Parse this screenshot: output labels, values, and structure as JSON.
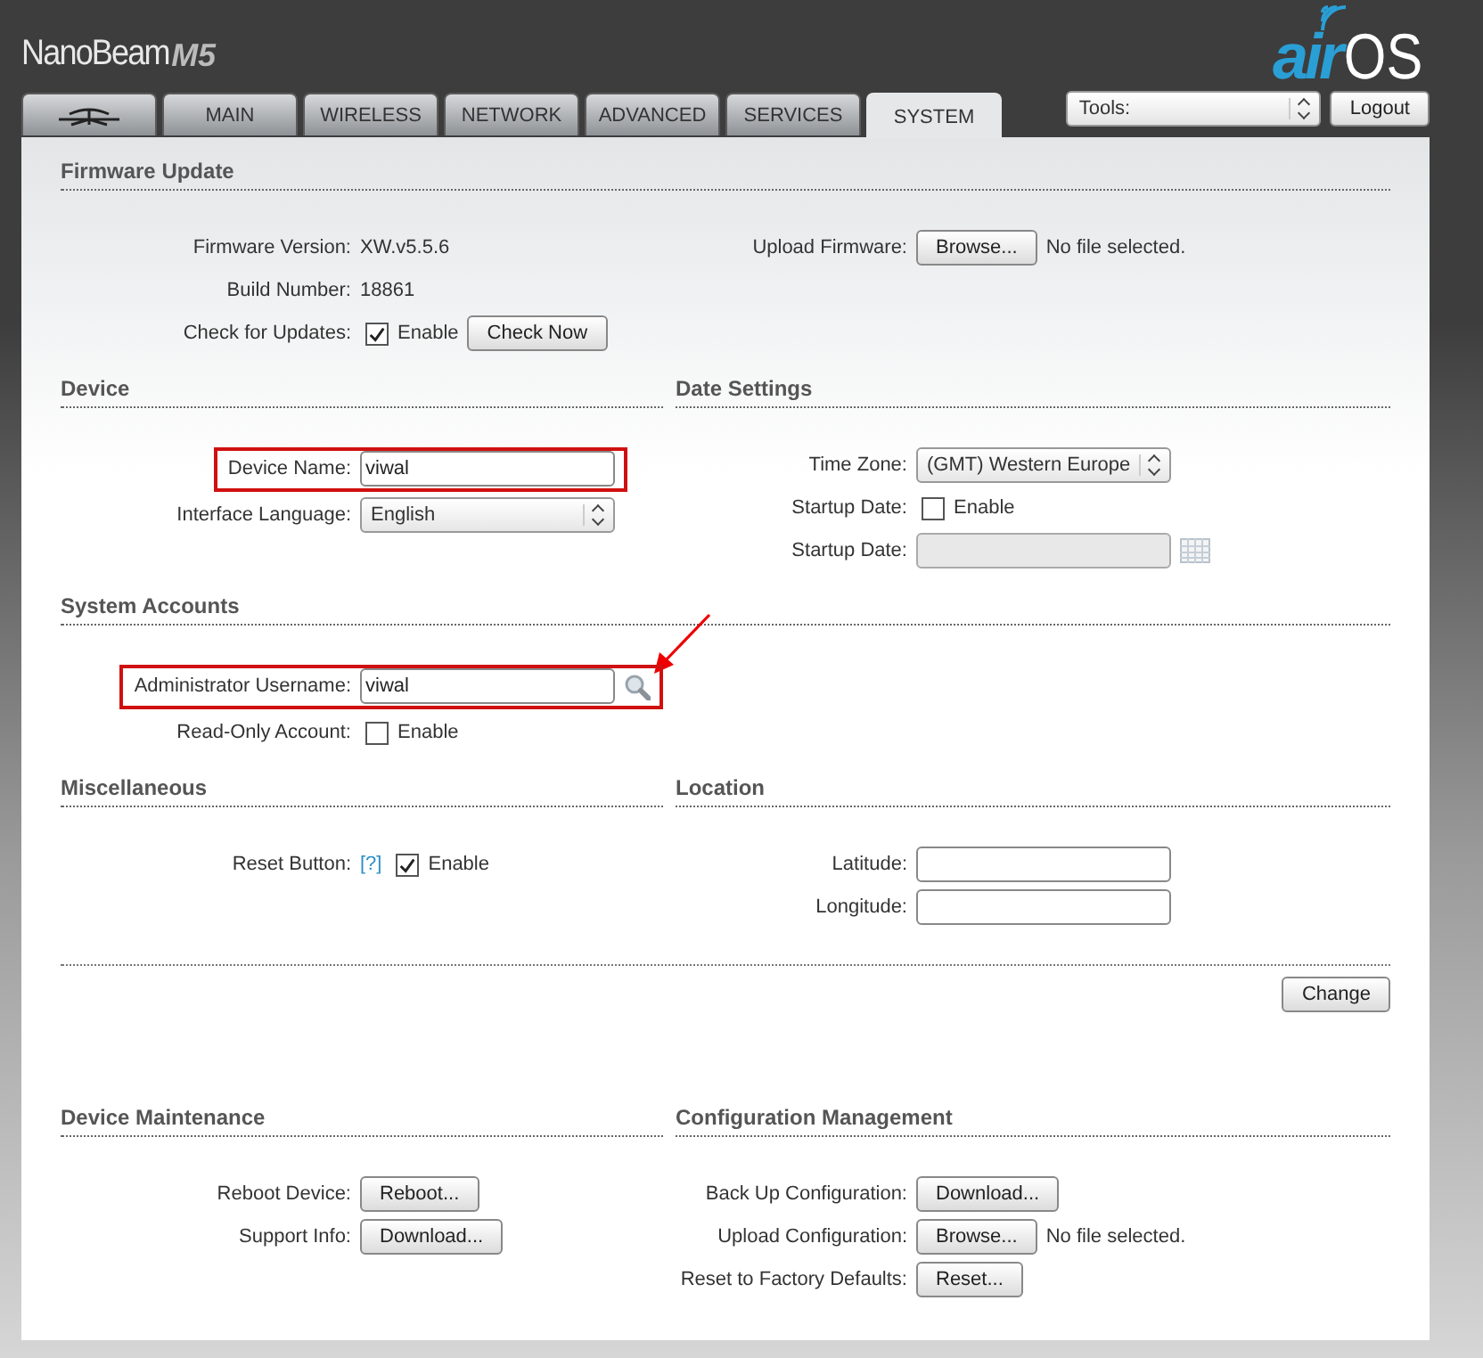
{
  "header": {
    "product": "NanoBeam",
    "model": "M5",
    "logo_prefix": "air",
    "logo_suffix": "OS"
  },
  "tabs": [
    {
      "kind": "icon",
      "selected": false
    },
    {
      "kind": "text",
      "label": "MAIN",
      "selected": false
    },
    {
      "kind": "text",
      "label": "WIRELESS",
      "selected": false
    },
    {
      "kind": "text",
      "label": "NETWORK",
      "selected": false
    },
    {
      "kind": "text",
      "label": "ADVANCED",
      "selected": false
    },
    {
      "kind": "text",
      "label": "SERVICES",
      "selected": false
    },
    {
      "kind": "text",
      "label": "SYSTEM",
      "selected": true
    }
  ],
  "tools": {
    "value": "Tools:"
  },
  "logout": "Logout",
  "blocks": [
    {
      "kind": "sections",
      "title": "Firmware Update",
      "columns": [
        {
          "fields": [
            {
              "label": "Firmware Version:",
              "highlighted": false,
              "controls": [
                {
                  "kind": "value",
                  "text": "XW.v5.5.6"
                }
              ]
            },
            {
              "label": "Build Number:",
              "highlighted": false,
              "controls": [
                {
                  "kind": "value",
                  "text": "18861"
                }
              ]
            },
            {
              "label": "Check for Updates:",
              "highlighted": false,
              "controls": [
                {
                  "kind": "checkbox",
                  "checked": true,
                  "text": "Enable"
                },
                {
                  "kind": "button",
                  "text": "Check Now"
                }
              ]
            }
          ]
        },
        {
          "fields": [
            {
              "label": "Upload Firmware:",
              "highlighted": false,
              "controls": [
                {
                  "kind": "button",
                  "text": "Browse..."
                },
                {
                  "kind": "note",
                  "text": "No file selected."
                }
              ]
            }
          ]
        }
      ]
    },
    {
      "kind": "sections",
      "columns": [
        {
          "title": "Device",
          "fields": [
            {
              "label": "Device Name:",
              "highlighted": true,
              "controls": [
                {
                  "kind": "input",
                  "value": "viwal"
                }
              ]
            },
            {
              "label": "Interface Language:",
              "highlighted": false,
              "controls": [
                {
                  "kind": "select",
                  "value": "English"
                }
              ]
            }
          ]
        },
        {
          "title": "Date Settings",
          "fields": [
            {
              "label": "Time Zone:",
              "highlighted": false,
              "controls": [
                {
                  "kind": "select",
                  "value": "(GMT) Western Europe"
                }
              ]
            },
            {
              "label": "Startup Date:",
              "highlighted": false,
              "controls": [
                {
                  "kind": "checkbox",
                  "checked": false,
                  "text": "Enable"
                }
              ]
            },
            {
              "label": "Startup Date:",
              "highlighted": false,
              "controls": [
                {
                  "kind": "date",
                  "disabled": true
                }
              ]
            }
          ]
        }
      ]
    },
    {
      "kind": "sections",
      "title": "System Accounts",
      "columns": [
        {
          "fields": [
            {
              "label": "Administrator Username:",
              "highlighted": true,
              "controls": [
                {
                  "kind": "input",
                  "value": "viwal"
                },
                {
                  "kind": "search",
                  "pointer": true
                }
              ]
            },
            {
              "label": "Read-Only Account:",
              "highlighted": false,
              "controls": [
                {
                  "kind": "checkbox",
                  "checked": false,
                  "text": "Enable"
                }
              ]
            }
          ]
        }
      ]
    },
    {
      "kind": "sections",
      "columns": [
        {
          "title": "Miscellaneous",
          "fields": [
            {
              "label": "Reset Button:",
              "highlighted": false,
              "controls": [
                {
                  "kind": "help",
                  "text": "[?]"
                },
                {
                  "kind": "checkbox",
                  "checked": true,
                  "text": "Enable"
                }
              ]
            }
          ]
        },
        {
          "title": "Location",
          "fields": [
            {
              "label": "Latitude:",
              "highlighted": false,
              "controls": [
                {
                  "kind": "input"
                }
              ]
            },
            {
              "label": "Longitude:",
              "highlighted": false,
              "controls": [
                {
                  "kind": "input"
                }
              ]
            }
          ]
        }
      ]
    },
    {
      "kind": "actions",
      "buttons": [
        "Change"
      ]
    },
    {
      "kind": "sections",
      "columns": [
        {
          "title": "Device Maintenance",
          "fields": [
            {
              "label": "Reboot Device:",
              "highlighted": false,
              "controls": [
                {
                  "kind": "button",
                  "text": "Reboot..."
                }
              ]
            },
            {
              "label": "Support Info:",
              "highlighted": false,
              "controls": [
                {
                  "kind": "button",
                  "text": "Download..."
                }
              ]
            }
          ]
        },
        {
          "title": "Configuration Management",
          "fields": [
            {
              "label": "Back Up Configuration:",
              "highlighted": false,
              "controls": [
                {
                  "kind": "button",
                  "text": "Download..."
                }
              ]
            },
            {
              "label": "Upload Configuration:",
              "highlighted": false,
              "controls": [
                {
                  "kind": "button",
                  "text": "Browse..."
                },
                {
                  "kind": "note",
                  "text": "No file selected."
                }
              ]
            },
            {
              "label": "Reset to Factory Defaults:",
              "highlighted": false,
              "controls": [
                {
                  "kind": "button",
                  "text": "Reset..."
                }
              ]
            }
          ]
        }
      ]
    }
  ]
}
